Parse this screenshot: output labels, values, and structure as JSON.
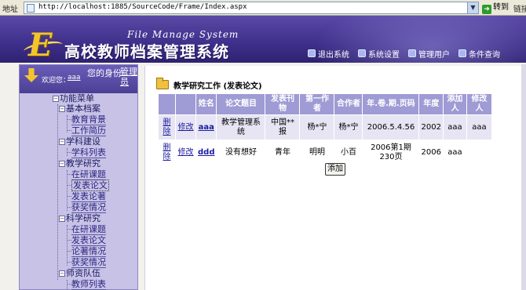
{
  "browser": {
    "address_label": "地址",
    "url": "http://localhost:1885/SourceCode/Frame/Index.aspx",
    "go_label": "转到",
    "links_label": "链接"
  },
  "banner": {
    "english_title": "File Manage System",
    "chinese_title": "高校教师档案管理系统",
    "logo_letter": "E",
    "nav": [
      {
        "label": "退出系统",
        "icon": "exit-icon"
      },
      {
        "label": "系统设置",
        "icon": "settings-icon"
      },
      {
        "label": "管理用户",
        "icon": "users-icon"
      },
      {
        "label": "条件查询",
        "icon": "search-icon"
      }
    ]
  },
  "sidebar": {
    "welcome_text": "欢迎您：",
    "username": "aaa",
    "identity_label": "您的身份:",
    "identity_value": "管理员",
    "menu_root": "功能菜单",
    "groups": [
      {
        "label": "基本档案",
        "items": [
          "教育背景",
          "工作简历"
        ]
      },
      {
        "label": "学科建设",
        "items": [
          "学科列表"
        ]
      },
      {
        "label": "教学研究",
        "items": [
          "在研课题",
          "发表论文",
          "发表论著",
          "获奖情况"
        ]
      },
      {
        "label": "科学研究",
        "items": [
          "在研课题",
          "发表论文",
          "论著情况",
          "获奖情况"
        ]
      },
      {
        "label": "师资队伍",
        "items": [
          "教师列表"
        ]
      }
    ]
  },
  "main": {
    "section_title": "教学研究工作 (发表论文)",
    "columns": [
      "",
      "",
      "姓名",
      "论文题目",
      "发表刊物",
      "第一作者",
      "合作者",
      "年.卷.期.页码",
      "年度",
      "添加人",
      "修改人"
    ],
    "rows": [
      {
        "delete": "删除",
        "edit": "修改",
        "name": "aaa",
        "title": "教学管理系统",
        "journal": "中国**报",
        "first_author": "杨*宁",
        "coauthor": "杨*宁",
        "citation": "2006.5.4.56",
        "year": "2002",
        "added_by": "aaa",
        "modified_by": "aaa"
      },
      {
        "delete": "删除",
        "edit": "修改",
        "name": "ddd",
        "title": "没有想好",
        "journal": "青年",
        "first_author": "明明",
        "coauthor": "小百",
        "citation": "2006第1期230页",
        "year": "2006",
        "added_by": "aaa",
        "modified_by": ""
      }
    ],
    "add_button": "添加"
  }
}
